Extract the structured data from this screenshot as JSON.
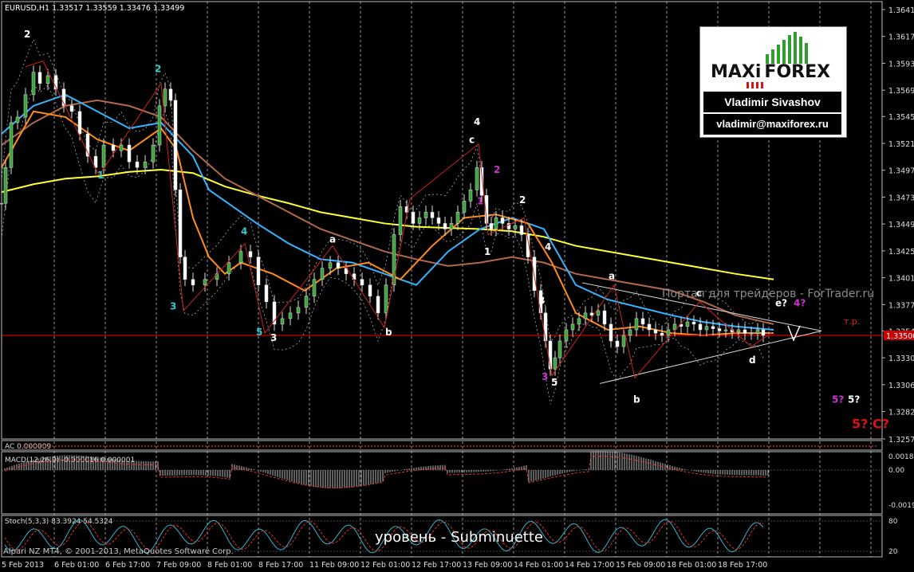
{
  "chart_data": {
    "type": "line",
    "title": "EURUSD,H1  1.33517 1.33559 1.33476 1.33499",
    "symbol": "EURUSD,H1",
    "quote": "1.33517 1.33559 1.33476 1.33499",
    "ylim": [
      1.32575,
      1.3641
    ],
    "y_ticks": [
      "1.36410",
      "1.36170",
      "1.35930",
      "1.35690",
      "1.35455",
      "1.35215",
      "1.34975",
      "1.34735",
      "1.34495",
      "1.34255",
      "1.34015",
      "1.33775",
      "1.33540",
      "1.33300",
      "1.33060",
      "1.32820",
      "1.32575"
    ],
    "current_price_label": "1.33500",
    "x_ticks": [
      "5 Feb 2013",
      "6 Feb 01:00",
      "6 Feb 17:00",
      "7 Feb 09:00",
      "8 Feb 01:00",
      "8 Feb 17:00",
      "11 Feb 09:00",
      "12 Feb 01:00",
      "12 Feb 17:00",
      "13 Feb 09:00",
      "14 Feb 01:00",
      "14 Feb 17:00",
      "15 Feb 09:00",
      "18 Feb 01:00",
      "18 Feb 17:00"
    ],
    "price_path_x": [
      0,
      5,
      12,
      20,
      30,
      40,
      48,
      58,
      68,
      78,
      88,
      98,
      108,
      118,
      128,
      140,
      150,
      160,
      170,
      180,
      190,
      198,
      205,
      212,
      218,
      224,
      230,
      240,
      255,
      270,
      285,
      300,
      312,
      322,
      332,
      342,
      352,
      362,
      372,
      382,
      392,
      402,
      412,
      422,
      432,
      442,
      452,
      462,
      472,
      482,
      492,
      500,
      508,
      516,
      524,
      532,
      540,
      548,
      556,
      564,
      572,
      580,
      588,
      596,
      602,
      608,
      614,
      620,
      628,
      636,
      644,
      652,
      660,
      668,
      676,
      682,
      688,
      694,
      700,
      708,
      716,
      724,
      732,
      740,
      748,
      756,
      764,
      772,
      780,
      788,
      796,
      804,
      812,
      820,
      828,
      836,
      844,
      852,
      860,
      868,
      876,
      884,
      892,
      900,
      908,
      916,
      924,
      932,
      940,
      948,
      955
    ],
    "price_path_y": [
      1.3468,
      1.35,
      1.354,
      1.3545,
      1.3565,
      1.3585,
      1.3575,
      1.3582,
      1.357,
      1.3555,
      1.355,
      1.353,
      1.351,
      1.35,
      1.352,
      1.3515,
      1.352,
      1.3505,
      1.35,
      1.3505,
      1.352,
      1.3555,
      1.357,
      1.356,
      1.348,
      1.342,
      1.34,
      1.3395,
      1.34,
      1.3405,
      1.3415,
      1.3425,
      1.342,
      1.3395,
      1.338,
      1.336,
      1.3365,
      1.337,
      1.3375,
      1.3385,
      1.34,
      1.341,
      1.3415,
      1.341,
      1.3405,
      1.34,
      1.3395,
      1.3385,
      1.337,
      1.3395,
      1.344,
      1.3465,
      1.346,
      1.345,
      1.3455,
      1.346,
      1.3455,
      1.345,
      1.3445,
      1.345,
      1.346,
      1.347,
      1.348,
      1.35,
      1.3475,
      1.345,
      1.3445,
      1.3455,
      1.345,
      1.3445,
      1.3448,
      1.344,
      1.342,
      1.339,
      1.337,
      1.3345,
      1.332,
      1.333,
      1.3345,
      1.3355,
      1.336,
      1.3365,
      1.337,
      1.3368,
      1.3372,
      1.336,
      1.3345,
      1.334,
      1.335,
      1.3355,
      1.3365,
      1.336,
      1.3355,
      1.3352,
      1.335,
      1.3355,
      1.336,
      1.3358,
      1.3362,
      1.336,
      1.3355,
      1.3358,
      1.3356,
      1.3354,
      1.3355,
      1.3353,
      1.3355,
      1.3352,
      1.3352,
      1.3355,
      1.335
    ],
    "overlays": [
      {
        "name": "MA slow",
        "color": "#ffff33",
        "x": [
          0,
          40,
          80,
          120,
          160,
          200,
          240,
          280,
          320,
          360,
          400,
          440,
          480,
          520,
          560,
          600,
          640,
          680,
          720,
          760,
          800,
          840,
          880,
          920,
          968
        ],
        "y": [
          1.3478,
          1.3485,
          1.349,
          1.3492,
          1.3496,
          1.3498,
          1.3495,
          1.3483,
          1.3475,
          1.3468,
          1.346,
          1.3455,
          1.345,
          1.3447,
          1.3446,
          1.3445,
          1.3443,
          1.3438,
          1.343,
          1.3425,
          1.342,
          1.3415,
          1.341,
          1.3405,
          1.34
        ]
      },
      {
        "name": "MA brown",
        "color": "#b06a4a",
        "x": [
          0,
          40,
          80,
          120,
          160,
          200,
          240,
          280,
          320,
          360,
          400,
          440,
          480,
          520,
          560,
          600,
          640,
          680,
          720,
          760,
          800,
          840,
          880,
          920,
          968
        ],
        "y": [
          1.352,
          1.354,
          1.3555,
          1.356,
          1.3555,
          1.3545,
          1.3515,
          1.349,
          1.3475,
          1.346,
          1.3445,
          1.3435,
          1.3425,
          1.3418,
          1.3412,
          1.3415,
          1.342,
          1.3415,
          1.3405,
          1.34,
          1.3395,
          1.339,
          1.338,
          1.3368,
          1.336
        ]
      },
      {
        "name": "MA blue",
        "color": "#33b5ff",
        "x": [
          0,
          40,
          80,
          120,
          160,
          200,
          240,
          260,
          280,
          320,
          360,
          400,
          440,
          480,
          520,
          560,
          600,
          640,
          680,
          700,
          720,
          760,
          800,
          840,
          880,
          920,
          968
        ],
        "y": [
          1.353,
          1.3555,
          1.3565,
          1.355,
          1.3535,
          1.354,
          1.351,
          1.348,
          1.347,
          1.345,
          1.3432,
          1.3418,
          1.3415,
          1.3405,
          1.3395,
          1.3425,
          1.3445,
          1.3455,
          1.3445,
          1.342,
          1.3395,
          1.3382,
          1.3375,
          1.3368,
          1.3362,
          1.3358,
          1.3355
        ]
      },
      {
        "name": "MA orange",
        "color": "#ff8c1a",
        "x": [
          0,
          40,
          80,
          120,
          160,
          200,
          220,
          240,
          260,
          280,
          300,
          340,
          380,
          420,
          460,
          500,
          540,
          580,
          620,
          660,
          690,
          720,
          760,
          800,
          840,
          880,
          920,
          968
        ],
        "y": [
          1.35,
          1.355,
          1.3545,
          1.3525,
          1.3515,
          1.3535,
          1.3515,
          1.3455,
          1.342,
          1.3405,
          1.3415,
          1.3405,
          1.339,
          1.341,
          1.3415,
          1.34,
          1.343,
          1.3455,
          1.3458,
          1.345,
          1.3415,
          1.337,
          1.3355,
          1.3358,
          1.3352,
          1.335,
          1.3352,
          1.3352
        ]
      }
    ],
    "horizontal_line": {
      "price": 1.335,
      "label": "т.р.",
      "color": "#cc0000"
    },
    "wave_labels": [
      {
        "text": "2",
        "color": "#ffffff",
        "x": 30,
        "y": 1.3616
      },
      {
        "text": "1",
        "color": "#33cccc",
        "x": 122,
        "y": 1.349
      },
      {
        "text": "2",
        "color": "#33cccc",
        "x": 194,
        "y": 1.3585
      },
      {
        "text": "3",
        "color": "#33cccc",
        "x": 213,
        "y": 1.3373
      },
      {
        "text": "4",
        "color": "#33cccc",
        "x": 302,
        "y": 1.344
      },
      {
        "text": "5",
        "color": "#33cccc",
        "x": 321,
        "y": 1.335
      },
      {
        "text": "3",
        "color": "#ffffff",
        "x": 339,
        "y": 1.3345
      },
      {
        "text": "a",
        "color": "#ffffff",
        "x": 413,
        "y": 1.3433
      },
      {
        "text": "b",
        "color": "#ffffff",
        "x": 483,
        "y": 1.335
      },
      {
        "text": "4",
        "color": "#ffffff",
        "x": 594,
        "y": 1.3538
      },
      {
        "text": "c",
        "color": "#ffffff",
        "x": 588,
        "y": 1.3522
      },
      {
        "text": "2",
        "color": "#cc33cc",
        "x": 619,
        "y": 1.3495
      },
      {
        "text": "1",
        "color": "#cc33cc",
        "x": 598,
        "y": 1.3467
      },
      {
        "text": "2",
        "color": "#ffffff",
        "x": 651,
        "y": 1.3468
      },
      {
        "text": "1",
        "color": "#ffffff",
        "x": 607,
        "y": 1.3422
      },
      {
        "text": "4",
        "color": "#ffffff",
        "x": 683,
        "y": 1.3426
      },
      {
        "text": "3",
        "color": "#ffffff",
        "x": 675,
        "y": 1.3378
      },
      {
        "text": "3",
        "color": "#cc33cc",
        "x": 679,
        "y": 1.331
      },
      {
        "text": "5",
        "color": "#ffffff",
        "x": 691,
        "y": 1.3305
      },
      {
        "text": "a",
        "color": "#ffffff",
        "x": 763,
        "y": 1.34
      },
      {
        "text": "b",
        "color": "#ffffff",
        "x": 794,
        "y": 1.329
      },
      {
        "text": "c",
        "color": "#ffffff",
        "x": 873,
        "y": 1.3385
      },
      {
        "text": "d",
        "color": "#ffffff",
        "x": 939,
        "y": 1.3325
      },
      {
        "text": "e?",
        "color": "#ffffff",
        "x": 972,
        "y": 1.3376
      },
      {
        "text": "4?",
        "color": "#cc33cc",
        "x": 995,
        "y": 1.3376
      },
      {
        "text": "5?",
        "color": "#cc33cc",
        "x": 1043,
        "y": 1.329
      },
      {
        "text": "5?",
        "color": "#ffffff",
        "x": 1063,
        "y": 1.329
      },
      {
        "text": "5? C?",
        "color": "#dd1111",
        "x": 1068,
        "y": 1.3267
      }
    ],
    "indicator_ac": {
      "label": "AC 0.000009"
    },
    "indicator_macd": {
      "label": "MACD(12,26,9) -0.000016 0.000001",
      "y_ticks": [
        "0.001891",
        "0.00",
        "-0.001930"
      ]
    },
    "indicator_stoch": {
      "label": "Stoch(5,3,3) 83.3924 54.5324",
      "y_ticks": [
        "80",
        "20"
      ]
    }
  },
  "logo": {
    "brand_left": "MAXi",
    "brand_right": "FOREX",
    "name": "Vladimir Sivashov",
    "email": "vladimir@maxiforex.ru"
  },
  "caption": "уровень - Subminuette",
  "watermark": "Портал для трейдеров - ForTrader.ru",
  "copyright": "Alpari NZ MT4, © 2001-2013, MetaQuotes Software Corp."
}
